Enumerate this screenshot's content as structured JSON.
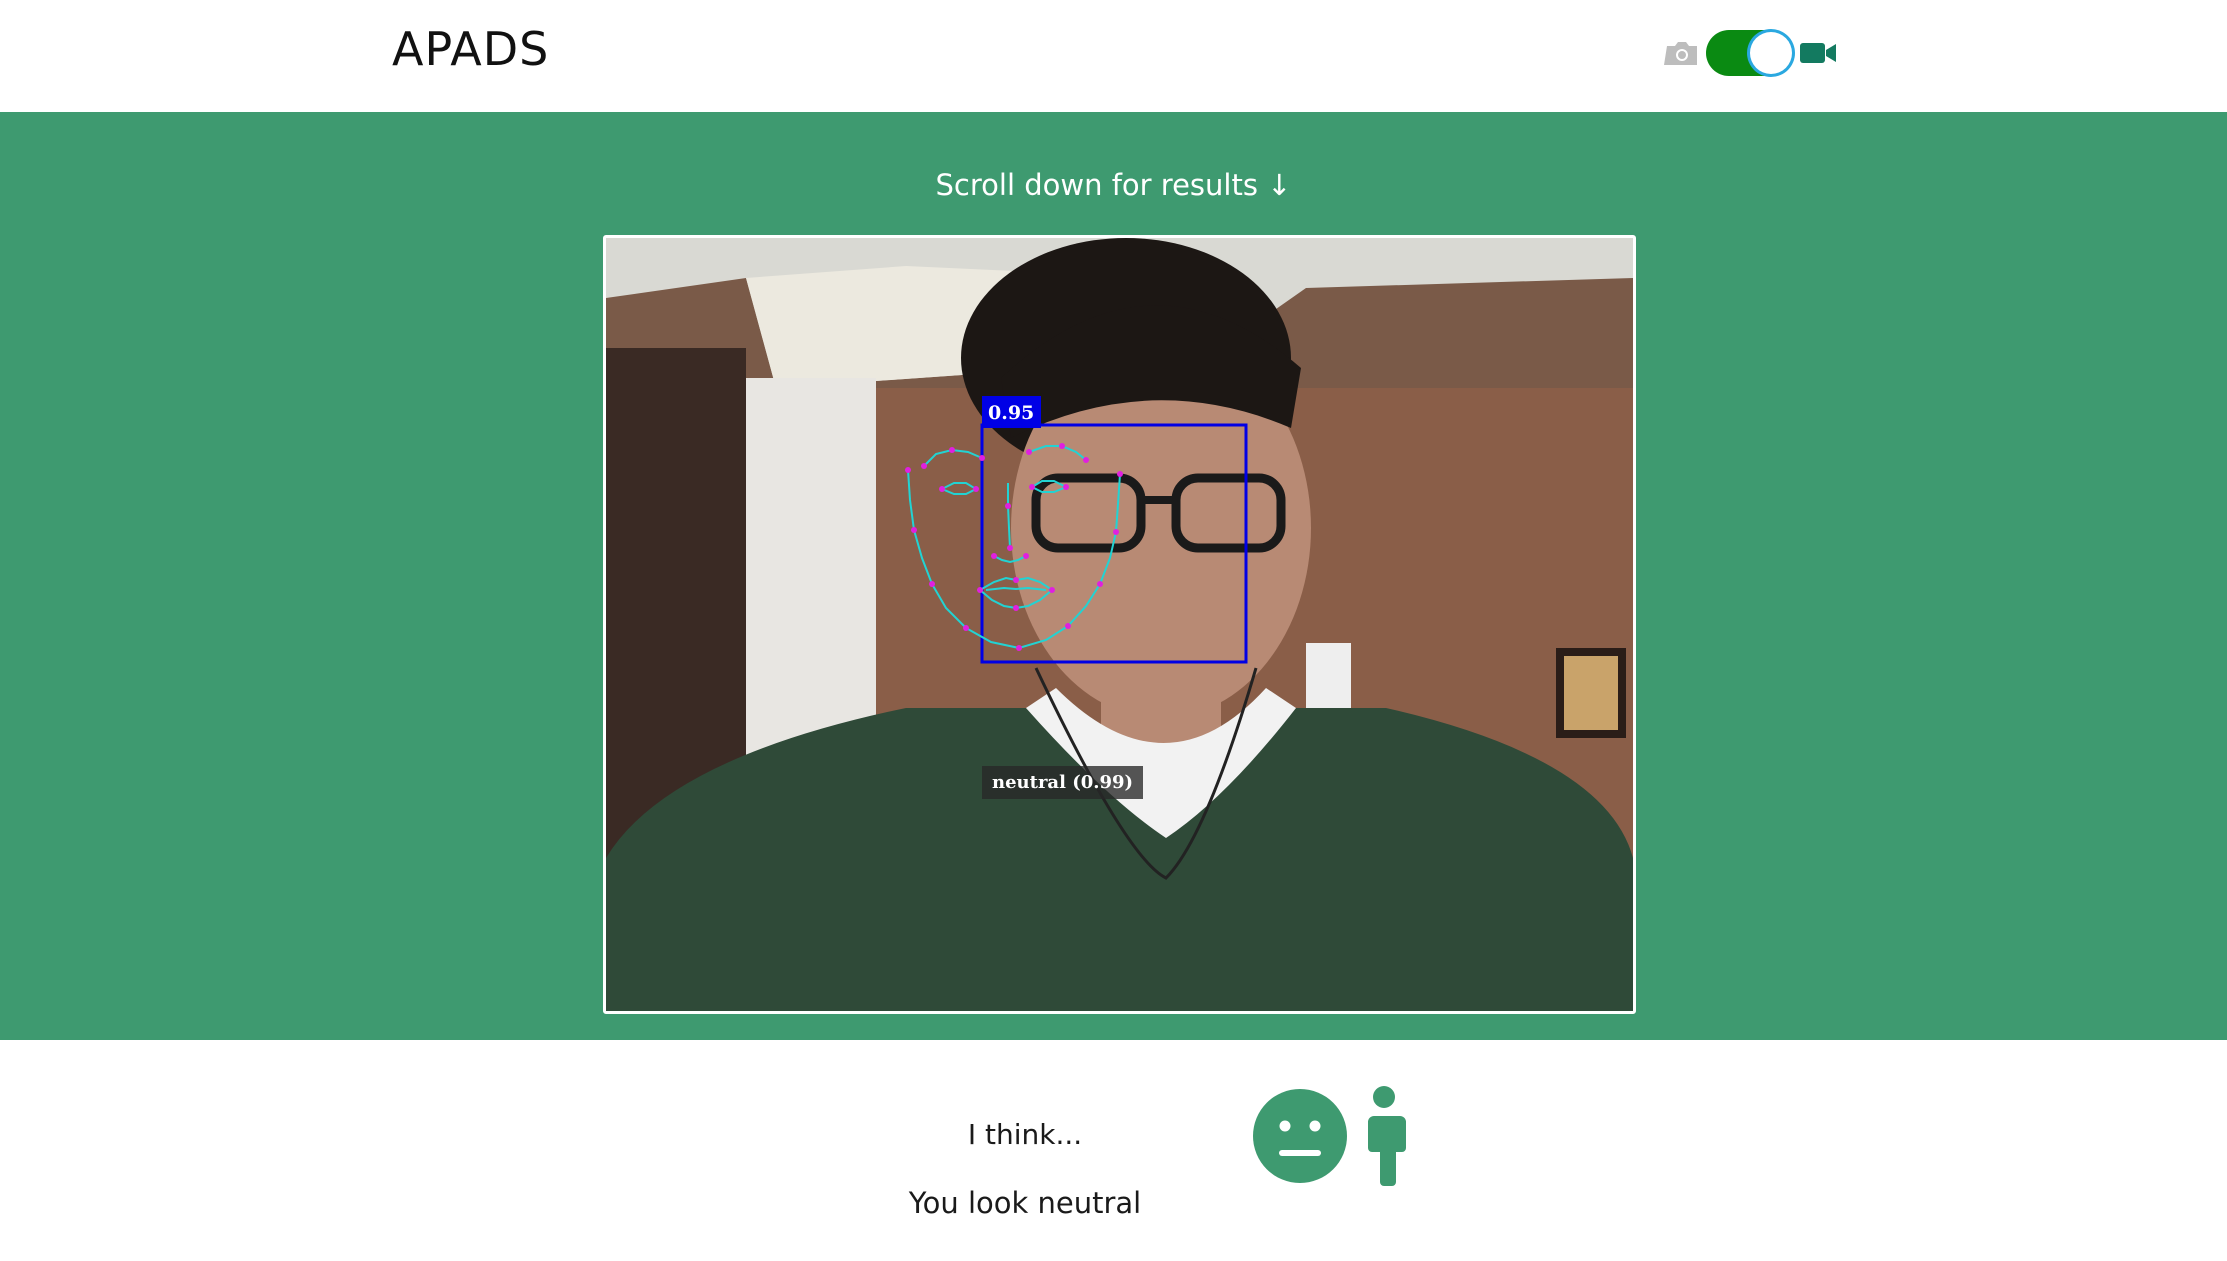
{
  "header": {
    "brand": "APADS",
    "mode_switch": {
      "left_icon": "camera-icon",
      "right_icon": "video-camera-icon",
      "state": "video",
      "on_color": "#0a8a12"
    }
  },
  "main": {
    "scroll_hint": "Scroll down for results ↓",
    "band_color": "#3e9a70",
    "detection": {
      "score": "0.95",
      "emotion_label": "neutral (0.99)",
      "box_color": "#0000e6",
      "landmark_line_color": "#22d3d3",
      "landmark_point_color": "#e020e0"
    }
  },
  "result": {
    "intro": "I think...",
    "text": "You look neutral",
    "icons": [
      "neutral-face-icon",
      "person-icon"
    ],
    "icon_color": "#3e9a70"
  }
}
